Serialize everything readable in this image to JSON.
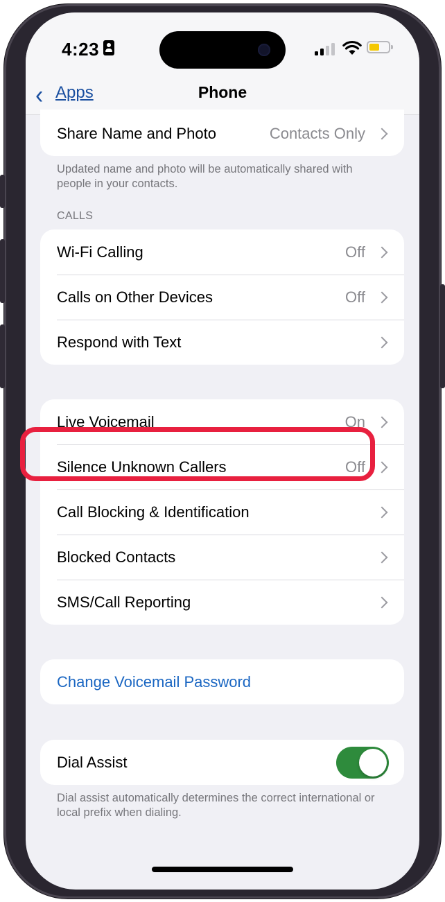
{
  "status_bar": {
    "time": "4:23",
    "battery_color": "#f5c800",
    "icons": [
      "id-card-icon",
      "cellular-signal-icon",
      "wifi-icon",
      "battery-icon"
    ]
  },
  "nav": {
    "back_label": "Apps",
    "title": "Phone"
  },
  "share_card": {
    "label": "Share Name and Photo",
    "value": "Contacts Only",
    "footnote": "Updated name and photo will be automatically shared with people in your contacts."
  },
  "calls_section": {
    "header": "CALLS",
    "rows": [
      {
        "label": "Wi-Fi Calling",
        "value": "Off"
      },
      {
        "label": "Calls on Other Devices",
        "value": "Off"
      },
      {
        "label": "Respond with Text",
        "value": ""
      }
    ]
  },
  "voicemail_section": {
    "rows": [
      {
        "label": "Live Voicemail",
        "value": "On"
      },
      {
        "label": "Silence Unknown Callers",
        "value": "Off"
      },
      {
        "label": "Call Blocking & Identification",
        "value": ""
      },
      {
        "label": "Blocked Contacts",
        "value": ""
      },
      {
        "label": "SMS/Call Reporting",
        "value": ""
      }
    ]
  },
  "password_section": {
    "label": "Change Voicemail Password"
  },
  "dial_assist": {
    "label": "Dial Assist",
    "enabled": true,
    "toggle_color": "#2e8b3c",
    "footnote": "Dial assist automatically determines the correct international or local prefix when dialing."
  },
  "colors": {
    "accent": "#1a66c2",
    "highlight": "#e8203f",
    "background": "#f0f0f5"
  }
}
